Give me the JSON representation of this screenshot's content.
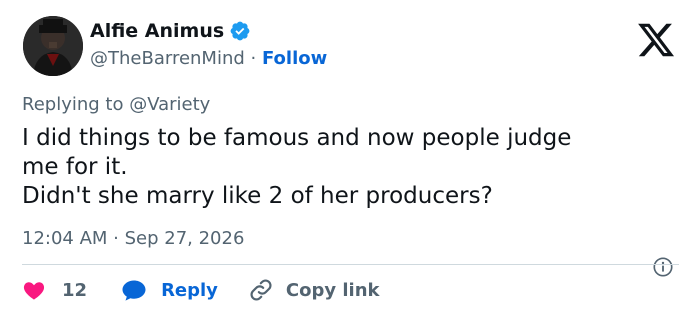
{
  "tweet": {
    "author_name": "Alfie Animus",
    "handle": "@TheBarrenMind",
    "separator": " · ",
    "follow_label": "Follow",
    "replying_prefix": "Replying to ",
    "replying_to": "@Variety",
    "text_lines": [
      "I did things to be famous and now people judge",
      "me for it.",
      "Didn't she marry like 2 of her producers?"
    ],
    "timestamp": "12:04 AM · Sep 27, 2026"
  },
  "actions": {
    "likes": "12",
    "reply_label": "Reply",
    "copy_link_label": "Copy link"
  },
  "colors": {
    "verified": "#1d9bf0",
    "like": "#f91880",
    "link": "#0866d6"
  }
}
